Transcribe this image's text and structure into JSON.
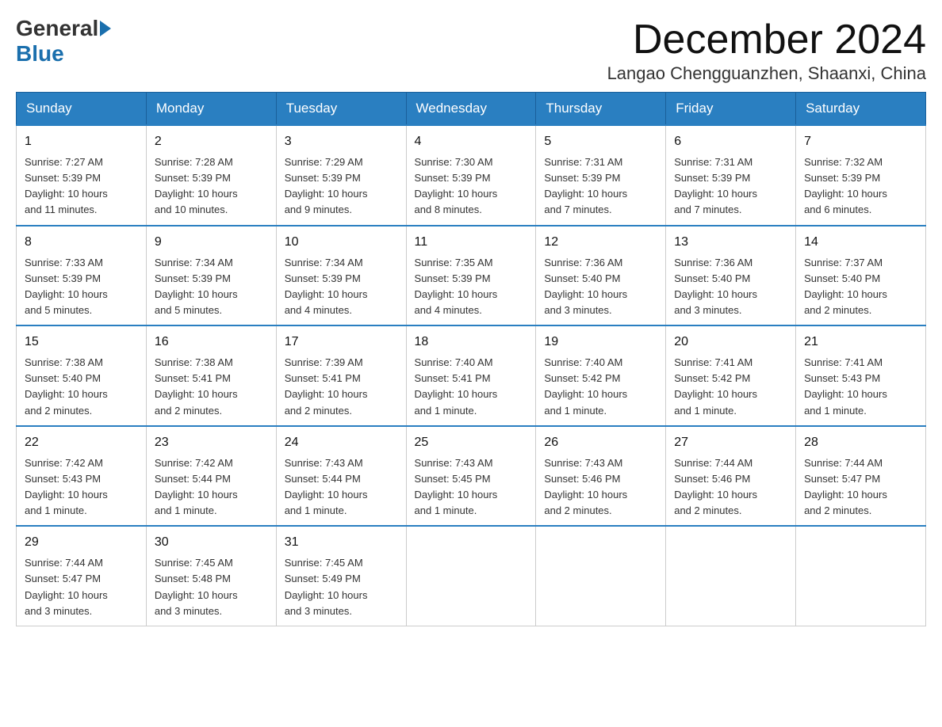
{
  "logo": {
    "general": "General",
    "blue": "Blue"
  },
  "title": "December 2024",
  "subtitle": "Langao Chengguanzhen, Shaanxi, China",
  "days_of_week": [
    "Sunday",
    "Monday",
    "Tuesday",
    "Wednesday",
    "Thursday",
    "Friday",
    "Saturday"
  ],
  "weeks": [
    [
      {
        "day": "1",
        "sunrise": "7:27 AM",
        "sunset": "5:39 PM",
        "daylight": "10 hours and 11 minutes."
      },
      {
        "day": "2",
        "sunrise": "7:28 AM",
        "sunset": "5:39 PM",
        "daylight": "10 hours and 10 minutes."
      },
      {
        "day": "3",
        "sunrise": "7:29 AM",
        "sunset": "5:39 PM",
        "daylight": "10 hours and 9 minutes."
      },
      {
        "day": "4",
        "sunrise": "7:30 AM",
        "sunset": "5:39 PM",
        "daylight": "10 hours and 8 minutes."
      },
      {
        "day": "5",
        "sunrise": "7:31 AM",
        "sunset": "5:39 PM",
        "daylight": "10 hours and 7 minutes."
      },
      {
        "day": "6",
        "sunrise": "7:31 AM",
        "sunset": "5:39 PM",
        "daylight": "10 hours and 7 minutes."
      },
      {
        "day": "7",
        "sunrise": "7:32 AM",
        "sunset": "5:39 PM",
        "daylight": "10 hours and 6 minutes."
      }
    ],
    [
      {
        "day": "8",
        "sunrise": "7:33 AM",
        "sunset": "5:39 PM",
        "daylight": "10 hours and 5 minutes."
      },
      {
        "day": "9",
        "sunrise": "7:34 AM",
        "sunset": "5:39 PM",
        "daylight": "10 hours and 5 minutes."
      },
      {
        "day": "10",
        "sunrise": "7:34 AM",
        "sunset": "5:39 PM",
        "daylight": "10 hours and 4 minutes."
      },
      {
        "day": "11",
        "sunrise": "7:35 AM",
        "sunset": "5:39 PM",
        "daylight": "10 hours and 4 minutes."
      },
      {
        "day": "12",
        "sunrise": "7:36 AM",
        "sunset": "5:40 PM",
        "daylight": "10 hours and 3 minutes."
      },
      {
        "day": "13",
        "sunrise": "7:36 AM",
        "sunset": "5:40 PM",
        "daylight": "10 hours and 3 minutes."
      },
      {
        "day": "14",
        "sunrise": "7:37 AM",
        "sunset": "5:40 PM",
        "daylight": "10 hours and 2 minutes."
      }
    ],
    [
      {
        "day": "15",
        "sunrise": "7:38 AM",
        "sunset": "5:40 PM",
        "daylight": "10 hours and 2 minutes."
      },
      {
        "day": "16",
        "sunrise": "7:38 AM",
        "sunset": "5:41 PM",
        "daylight": "10 hours and 2 minutes."
      },
      {
        "day": "17",
        "sunrise": "7:39 AM",
        "sunset": "5:41 PM",
        "daylight": "10 hours and 2 minutes."
      },
      {
        "day": "18",
        "sunrise": "7:40 AM",
        "sunset": "5:41 PM",
        "daylight": "10 hours and 1 minute."
      },
      {
        "day": "19",
        "sunrise": "7:40 AM",
        "sunset": "5:42 PM",
        "daylight": "10 hours and 1 minute."
      },
      {
        "day": "20",
        "sunrise": "7:41 AM",
        "sunset": "5:42 PM",
        "daylight": "10 hours and 1 minute."
      },
      {
        "day": "21",
        "sunrise": "7:41 AM",
        "sunset": "5:43 PM",
        "daylight": "10 hours and 1 minute."
      }
    ],
    [
      {
        "day": "22",
        "sunrise": "7:42 AM",
        "sunset": "5:43 PM",
        "daylight": "10 hours and 1 minute."
      },
      {
        "day": "23",
        "sunrise": "7:42 AM",
        "sunset": "5:44 PM",
        "daylight": "10 hours and 1 minute."
      },
      {
        "day": "24",
        "sunrise": "7:43 AM",
        "sunset": "5:44 PM",
        "daylight": "10 hours and 1 minute."
      },
      {
        "day": "25",
        "sunrise": "7:43 AM",
        "sunset": "5:45 PM",
        "daylight": "10 hours and 1 minute."
      },
      {
        "day": "26",
        "sunrise": "7:43 AM",
        "sunset": "5:46 PM",
        "daylight": "10 hours and 2 minutes."
      },
      {
        "day": "27",
        "sunrise": "7:44 AM",
        "sunset": "5:46 PM",
        "daylight": "10 hours and 2 minutes."
      },
      {
        "day": "28",
        "sunrise": "7:44 AM",
        "sunset": "5:47 PM",
        "daylight": "10 hours and 2 minutes."
      }
    ],
    [
      {
        "day": "29",
        "sunrise": "7:44 AM",
        "sunset": "5:47 PM",
        "daylight": "10 hours and 3 minutes."
      },
      {
        "day": "30",
        "sunrise": "7:45 AM",
        "sunset": "5:48 PM",
        "daylight": "10 hours and 3 minutes."
      },
      {
        "day": "31",
        "sunrise": "7:45 AM",
        "sunset": "5:49 PM",
        "daylight": "10 hours and 3 minutes."
      },
      null,
      null,
      null,
      null
    ]
  ],
  "labels": {
    "sunrise": "Sunrise:",
    "sunset": "Sunset:",
    "daylight": "Daylight:"
  }
}
